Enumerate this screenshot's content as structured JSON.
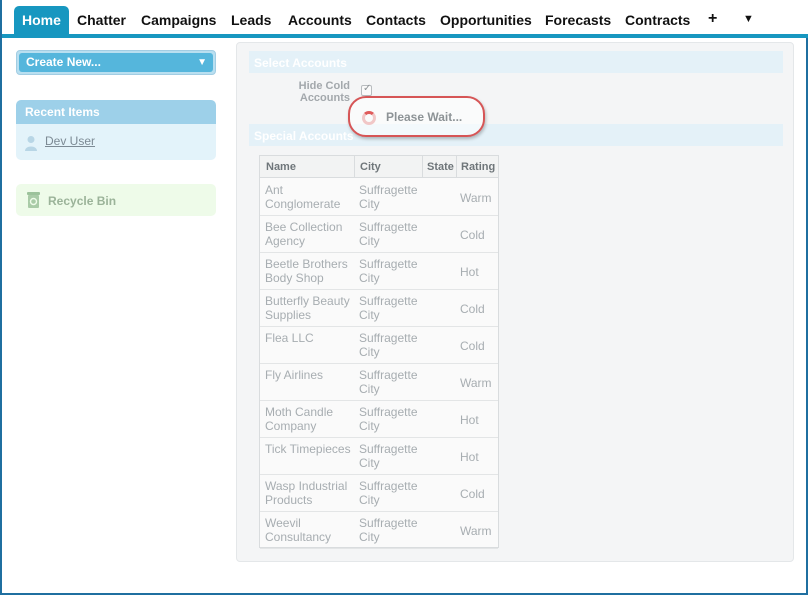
{
  "nav": {
    "tabs": [
      {
        "label": "Home"
      },
      {
        "label": "Chatter"
      },
      {
        "label": "Campaigns"
      },
      {
        "label": "Leads"
      },
      {
        "label": "Accounts"
      },
      {
        "label": "Contacts"
      },
      {
        "label": "Opportunities"
      },
      {
        "label": "Forecasts"
      },
      {
        "label": "Contracts"
      }
    ],
    "plus_icon": "+",
    "more_icon": "▼",
    "active_color": "#1797c0"
  },
  "sidebar": {
    "create_new": "Create New...",
    "create_new_caret": "▼",
    "recent_items_title": "Recent Items",
    "recent_items": [
      {
        "label": "Dev User",
        "icon": "user-icon"
      }
    ],
    "recycle_bin": {
      "label": "Recycle Bin",
      "icon": "recycle-bin-icon"
    }
  },
  "main": {
    "select_accounts_title": "Select Accounts",
    "hide_cold_label": "Hide Cold Accounts",
    "hide_cold_checked": "✓",
    "please_wait": "Please Wait...",
    "special_accounts_title": "Special Accounts",
    "table": {
      "columns": [
        "Name",
        "City",
        "State",
        "Rating"
      ],
      "rows": [
        {
          "name": "Ant Conglomerate",
          "city": "Suffragette City",
          "state": "",
          "rating": "Warm"
        },
        {
          "name": "Bee Collection Agency",
          "city": "Suffragette City",
          "state": "",
          "rating": "Cold"
        },
        {
          "name": "Beetle Brothers Body Shop",
          "city": "Suffragette City",
          "state": "",
          "rating": "Hot"
        },
        {
          "name": "Butterfly Beauty Supplies",
          "city": "Suffragette City",
          "state": "",
          "rating": "Cold"
        },
        {
          "name": "Flea LLC",
          "city": "Suffragette City",
          "state": "",
          "rating": "Cold"
        },
        {
          "name": "Fly Airlines",
          "city": "Suffragette City",
          "state": "",
          "rating": "Warm"
        },
        {
          "name": "Moth Candle Company",
          "city": "Suffragette City",
          "state": "",
          "rating": "Hot"
        },
        {
          "name": "Tick Timepieces",
          "city": "Suffragette City",
          "state": "",
          "rating": "Hot"
        },
        {
          "name": "Wasp Industrial Products",
          "city": "Suffragette City",
          "state": "",
          "rating": "Cold"
        },
        {
          "name": "Weevil Consultancy",
          "city": "Suffragette City",
          "state": "",
          "rating": "Warm"
        }
      ]
    }
  }
}
